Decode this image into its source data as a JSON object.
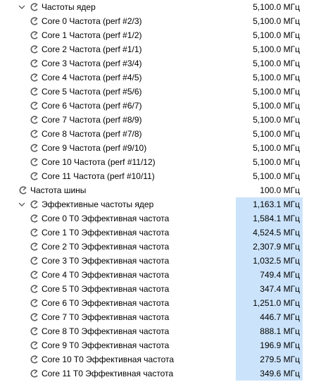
{
  "sections": {
    "core_clocks": {
      "label": "Частоты ядер",
      "value": "5,100.0 МГц",
      "items": [
        {
          "label": "Core 0 Частота (perf #2/3)",
          "value": "5,100.0 МГц"
        },
        {
          "label": "Core 1 Частота (perf #1/2)",
          "value": "5,100.0 МГц"
        },
        {
          "label": "Core 2 Частота (perf #1/1)",
          "value": "5,100.0 МГц"
        },
        {
          "label": "Core 3 Частота (perf #3/4)",
          "value": "5,100.0 МГц"
        },
        {
          "label": "Core 4 Частота (perf #4/5)",
          "value": "5,100.0 МГц"
        },
        {
          "label": "Core 5 Частота (perf #5/6)",
          "value": "5,100.0 МГц"
        },
        {
          "label": "Core 6 Частота (perf #6/7)",
          "value": "5,100.0 МГц"
        },
        {
          "label": "Core 7 Частота (perf #8/9)",
          "value": "5,100.0 МГц"
        },
        {
          "label": "Core 8 Частота (perf #7/8)",
          "value": "5,100.0 МГц"
        },
        {
          "label": "Core 9 Частота (perf #9/10)",
          "value": "5,100.0 МГц"
        },
        {
          "label": "Core 10 Частота (perf #11/12)",
          "value": "5,100.0 МГц"
        },
        {
          "label": "Core 11 Частота (perf #10/11)",
          "value": "5,100.0 МГц"
        }
      ]
    },
    "bus_clock": {
      "label": "Частота шины",
      "value": "100.0 МГц"
    },
    "effective_clocks": {
      "label": "Эффективные частоты ядер",
      "value": "1,163.1 МГц",
      "items": [
        {
          "label": "Core 0 T0 Эффективная частота",
          "value": "1,584.1 МГц"
        },
        {
          "label": "Core 1 T0 Эффективная частота",
          "value": "4,524.5 МГц"
        },
        {
          "label": "Core 2 T0 Эффективная частота",
          "value": "2,307.9 МГц"
        },
        {
          "label": "Core 3 T0 Эффективная частота",
          "value": "1,032.5 МГц"
        },
        {
          "label": "Core 4 T0 Эффективная частота",
          "value": "749.4 МГц"
        },
        {
          "label": "Core 5 T0 Эффективная частота",
          "value": "347.4 МГц"
        },
        {
          "label": "Core 6 T0 Эффективная частота",
          "value": "1,251.0 МГц"
        },
        {
          "label": "Core 7 T0 Эффективная частота",
          "value": "446.7 МГц"
        },
        {
          "label": "Core 8 T0 Эффективная частота",
          "value": "888.1 МГц"
        },
        {
          "label": "Core 9 T0 Эффективная частота",
          "value": "196.9 МГц"
        },
        {
          "label": "Core 10 T0 Эффективная частота",
          "value": "279.5 МГц"
        },
        {
          "label": "Core 11 T0 Эффективная частота",
          "value": "349.6 МГц"
        }
      ]
    }
  },
  "icons": {
    "expanded": "chevron-down-icon",
    "sensor": "clock-gauge-icon"
  },
  "colors": {
    "highlight": "#cce4fb",
    "icon": "#5a5a5a"
  }
}
